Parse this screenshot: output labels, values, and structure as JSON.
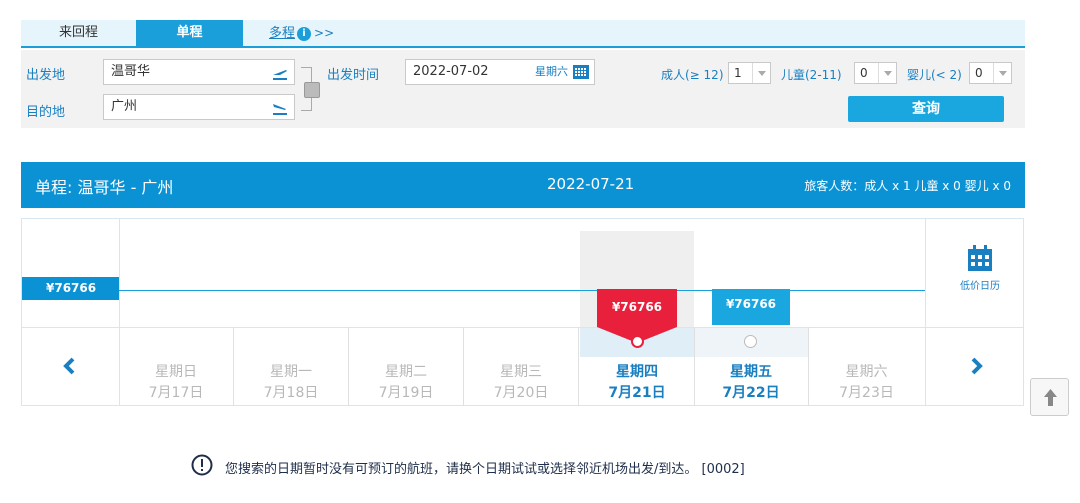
{
  "tabs": {
    "roundtrip": "来回程",
    "oneway": "单程",
    "multi": "多程",
    "multi_arrows": ">>"
  },
  "form": {
    "origin_label": "出发地",
    "origin_value": "温哥华",
    "dest_label": "目的地",
    "dest_value": "广州",
    "date_label": "出发时间",
    "date_value": "2022-07-02",
    "date_weekday": "星期六",
    "adult_label": "成人(≥ 12)",
    "adult_value": "1",
    "child_label": "儿童(2-11)",
    "child_value": "0",
    "infant_label": "婴儿(< 2)",
    "infant_value": "0",
    "search_button": "查询"
  },
  "result": {
    "route_title": "单程:  温哥华  -  广州",
    "date": "2022-07-21",
    "passengers": "旅客人数：成人 x 1   儿童 x 0   婴儿 x 0"
  },
  "chart": {
    "low_price": "¥76766",
    "selected_price": "¥76766",
    "next_price": "¥76766",
    "calendar_label": "低价日历",
    "days": [
      {
        "weekday": "星期日",
        "date": "7月17日"
      },
      {
        "weekday": "星期一",
        "date": "7月18日"
      },
      {
        "weekday": "星期二",
        "date": "7月19日"
      },
      {
        "weekday": "星期三",
        "date": "7月20日"
      },
      {
        "weekday": "星期四",
        "date": "7月21日"
      },
      {
        "weekday": "星期五",
        "date": "7月22日"
      },
      {
        "weekday": "星期六",
        "date": "7月23日"
      }
    ]
  },
  "message": "您搜索的日期暂时没有可预订的航班，请换个日期试试或选择邻近机场出发/到达。 [0002]",
  "colors": {
    "accent": "#0b92d4",
    "selected": "#e8203c",
    "text_link": "#1a7fc1"
  }
}
